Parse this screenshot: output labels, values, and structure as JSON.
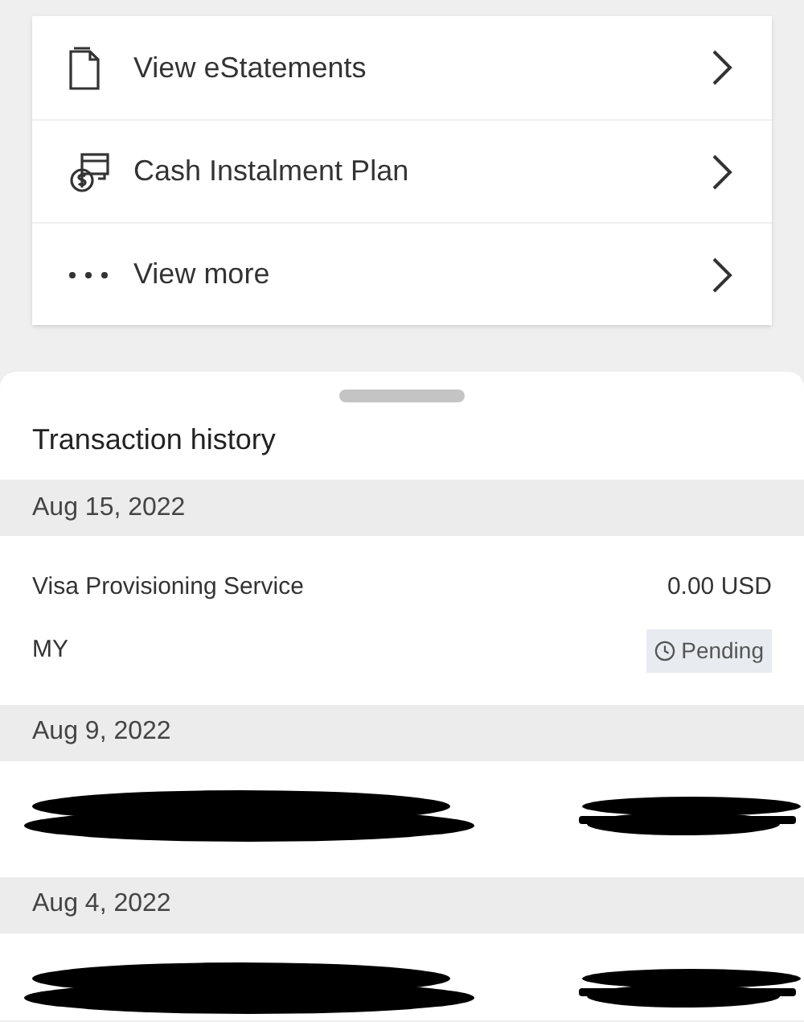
{
  "menu": [
    {
      "kind": "document",
      "label": "View eStatements"
    },
    {
      "kind": "instalment",
      "label": "Cash Instalment Plan"
    },
    {
      "kind": "more",
      "label": "View more"
    }
  ],
  "transaction_history": {
    "title": "Transaction history",
    "groups": [
      {
        "date": "Aug 15, 2022",
        "transactions": [
          {
            "kind": "plain",
            "merchant": "Visa Provisioning Service",
            "amount": "0.00 USD",
            "country": "MY",
            "status": "Pending"
          }
        ]
      },
      {
        "date": "Aug 9, 2022",
        "transactions": [
          {
            "kind": "redacted"
          }
        ]
      },
      {
        "date": "Aug 4, 2022",
        "transactions": [
          {
            "kind": "redacted"
          }
        ]
      }
    ]
  }
}
